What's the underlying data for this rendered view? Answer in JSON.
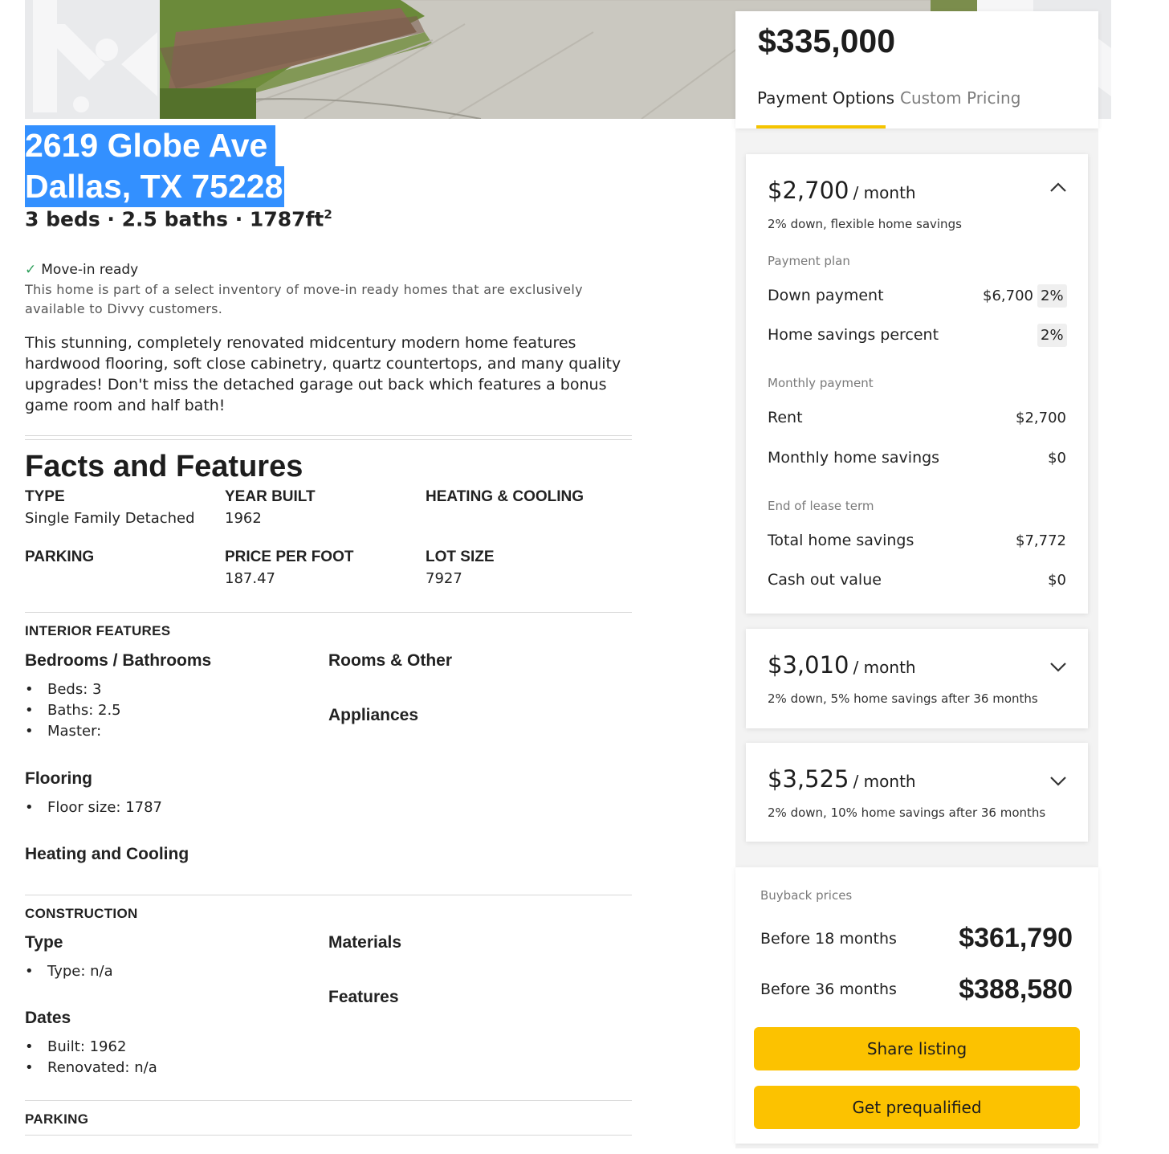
{
  "listing": {
    "address_line1": "2619 Globe Ave",
    "address_line2": "Dallas, TX 75228",
    "specs": "3 beds · 2.5 baths · 1787ft",
    "specs_sup": "2",
    "move_in_label": "Move-in ready",
    "move_in_desc": "This home is part of a select inventory of move-in ready homes that are exclusively available to Divvy customers.",
    "description": "This stunning, completely renovated midcentury modern home features hardwood flooring, soft close cabinetry, quartz countertops, and many quality upgrades! Don't miss the detached garage out back which features a bonus game room and half bath!"
  },
  "facts": {
    "title": "Facts and Features",
    "items": [
      {
        "label": "TYPE",
        "value": "Single Family Detached"
      },
      {
        "label": "YEAR BUILT",
        "value": "1962"
      },
      {
        "label": "HEATING & COOLING",
        "value": ""
      },
      {
        "label": "PARKING",
        "value": ""
      },
      {
        "label": "PRICE PER FOOT",
        "value": "187.47"
      },
      {
        "label": "LOT SIZE",
        "value": "7927"
      }
    ]
  },
  "interior": {
    "heading": "INTERIOR FEATURES",
    "bed_bath_title": "Bedrooms / Bathrooms",
    "bed_bath_items": [
      "Beds: 3",
      "Baths: 2.5",
      "Master:"
    ],
    "rooms_title": "Rooms & Other",
    "appliances_title": "Appliances",
    "flooring_title": "Flooring",
    "flooring_items": [
      "Floor size: 1787"
    ],
    "heating_title": "Heating and Cooling"
  },
  "construction": {
    "heading": "CONSTRUCTION",
    "type_title": "Type",
    "type_items": [
      "Type: n/a"
    ],
    "materials_title": "Materials",
    "features_title": "Features",
    "dates_title": "Dates",
    "dates_items": [
      "Built: 1962",
      "Renovated: n/a"
    ]
  },
  "parking": {
    "heading": "PARKING"
  },
  "pricing": {
    "price": "$335,000",
    "tabs": [
      "Payment Options",
      "Custom Pricing"
    ],
    "active_tab": "Payment Options",
    "accent": "#fcc200"
  },
  "plans": [
    {
      "amount": "$2,700",
      "per": "/ month",
      "summary": "2% down, flexible home savings",
      "expanded": true,
      "payment_plan_label": "Payment plan",
      "down_payment_label": "Down payment",
      "down_payment_value": "$6,700",
      "down_payment_pct": "2%",
      "home_savings_pct_label": "Home savings percent",
      "home_savings_pct": "2%",
      "monthly_payment_label": "Monthly payment",
      "rent_label": "Rent",
      "rent_value": "$2,700",
      "monthly_savings_label": "Monthly home savings",
      "monthly_savings_value": "$0",
      "end_of_lease_label": "End of lease term",
      "total_savings_label": "Total home savings",
      "total_savings_value": "$7,772",
      "cash_out_label": "Cash out value",
      "cash_out_value": "$0"
    },
    {
      "amount": "$3,010",
      "per": "/ month",
      "summary": "2% down, 5% home savings after 36 months",
      "expanded": false
    },
    {
      "amount": "$3,525",
      "per": "/ month",
      "summary": "2% down, 10% home savings after 36 months",
      "expanded": false
    }
  ],
  "buyback": {
    "label": "Buyback prices",
    "rows": [
      {
        "label": "Before 18 months",
        "value": "$361,790"
      },
      {
        "label": "Before 36 months",
        "value": "$388,580"
      }
    ]
  },
  "buttons": {
    "share": "Share listing",
    "prequalify": "Get prequalified"
  },
  "icons": {
    "chevron_up": "chevron-up-icon",
    "chevron_down": "chevron-down-icon",
    "check": "check-icon"
  }
}
